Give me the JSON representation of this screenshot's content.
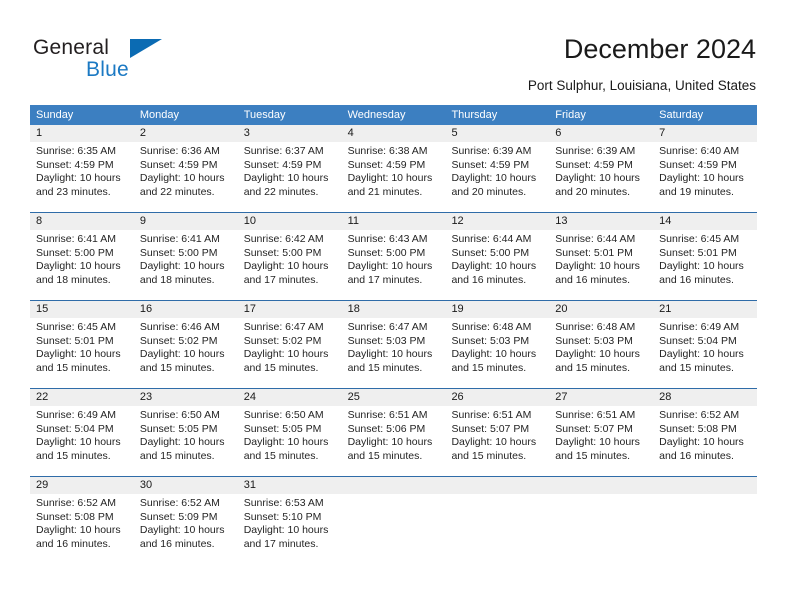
{
  "brand": {
    "name_part1": "General",
    "name_part2": "Blue",
    "accent_color": "#0b6bb3"
  },
  "header": {
    "title": "December 2024",
    "subtitle": "Port Sulphur, Louisiana, United States"
  },
  "calendar": {
    "header_bg": "#3c7fc1",
    "daynum_bg": "#efefef",
    "separator_color": "#2f6ca8",
    "weekdays": [
      "Sunday",
      "Monday",
      "Tuesday",
      "Wednesday",
      "Thursday",
      "Friday",
      "Saturday"
    ],
    "weeks": [
      {
        "days": [
          {
            "num": "1",
            "sunrise": "Sunrise: 6:35 AM",
            "sunset": "Sunset: 4:59 PM",
            "daylight1": "Daylight: 10 hours",
            "daylight2": "and 23 minutes."
          },
          {
            "num": "2",
            "sunrise": "Sunrise: 6:36 AM",
            "sunset": "Sunset: 4:59 PM",
            "daylight1": "Daylight: 10 hours",
            "daylight2": "and 22 minutes."
          },
          {
            "num": "3",
            "sunrise": "Sunrise: 6:37 AM",
            "sunset": "Sunset: 4:59 PM",
            "daylight1": "Daylight: 10 hours",
            "daylight2": "and 22 minutes."
          },
          {
            "num": "4",
            "sunrise": "Sunrise: 6:38 AM",
            "sunset": "Sunset: 4:59 PM",
            "daylight1": "Daylight: 10 hours",
            "daylight2": "and 21 minutes."
          },
          {
            "num": "5",
            "sunrise": "Sunrise: 6:39 AM",
            "sunset": "Sunset: 4:59 PM",
            "daylight1": "Daylight: 10 hours",
            "daylight2": "and 20 minutes."
          },
          {
            "num": "6",
            "sunrise": "Sunrise: 6:39 AM",
            "sunset": "Sunset: 4:59 PM",
            "daylight1": "Daylight: 10 hours",
            "daylight2": "and 20 minutes."
          },
          {
            "num": "7",
            "sunrise": "Sunrise: 6:40 AM",
            "sunset": "Sunset: 4:59 PM",
            "daylight1": "Daylight: 10 hours",
            "daylight2": "and 19 minutes."
          }
        ]
      },
      {
        "days": [
          {
            "num": "8",
            "sunrise": "Sunrise: 6:41 AM",
            "sunset": "Sunset: 5:00 PM",
            "daylight1": "Daylight: 10 hours",
            "daylight2": "and 18 minutes."
          },
          {
            "num": "9",
            "sunrise": "Sunrise: 6:41 AM",
            "sunset": "Sunset: 5:00 PM",
            "daylight1": "Daylight: 10 hours",
            "daylight2": "and 18 minutes."
          },
          {
            "num": "10",
            "sunrise": "Sunrise: 6:42 AM",
            "sunset": "Sunset: 5:00 PM",
            "daylight1": "Daylight: 10 hours",
            "daylight2": "and 17 minutes."
          },
          {
            "num": "11",
            "sunrise": "Sunrise: 6:43 AM",
            "sunset": "Sunset: 5:00 PM",
            "daylight1": "Daylight: 10 hours",
            "daylight2": "and 17 minutes."
          },
          {
            "num": "12",
            "sunrise": "Sunrise: 6:44 AM",
            "sunset": "Sunset: 5:00 PM",
            "daylight1": "Daylight: 10 hours",
            "daylight2": "and 16 minutes."
          },
          {
            "num": "13",
            "sunrise": "Sunrise: 6:44 AM",
            "sunset": "Sunset: 5:01 PM",
            "daylight1": "Daylight: 10 hours",
            "daylight2": "and 16 minutes."
          },
          {
            "num": "14",
            "sunrise": "Sunrise: 6:45 AM",
            "sunset": "Sunset: 5:01 PM",
            "daylight1": "Daylight: 10 hours",
            "daylight2": "and 16 minutes."
          }
        ]
      },
      {
        "days": [
          {
            "num": "15",
            "sunrise": "Sunrise: 6:45 AM",
            "sunset": "Sunset: 5:01 PM",
            "daylight1": "Daylight: 10 hours",
            "daylight2": "and 15 minutes."
          },
          {
            "num": "16",
            "sunrise": "Sunrise: 6:46 AM",
            "sunset": "Sunset: 5:02 PM",
            "daylight1": "Daylight: 10 hours",
            "daylight2": "and 15 minutes."
          },
          {
            "num": "17",
            "sunrise": "Sunrise: 6:47 AM",
            "sunset": "Sunset: 5:02 PM",
            "daylight1": "Daylight: 10 hours",
            "daylight2": "and 15 minutes."
          },
          {
            "num": "18",
            "sunrise": "Sunrise: 6:47 AM",
            "sunset": "Sunset: 5:03 PM",
            "daylight1": "Daylight: 10 hours",
            "daylight2": "and 15 minutes."
          },
          {
            "num": "19",
            "sunrise": "Sunrise: 6:48 AM",
            "sunset": "Sunset: 5:03 PM",
            "daylight1": "Daylight: 10 hours",
            "daylight2": "and 15 minutes."
          },
          {
            "num": "20",
            "sunrise": "Sunrise: 6:48 AM",
            "sunset": "Sunset: 5:03 PM",
            "daylight1": "Daylight: 10 hours",
            "daylight2": "and 15 minutes."
          },
          {
            "num": "21",
            "sunrise": "Sunrise: 6:49 AM",
            "sunset": "Sunset: 5:04 PM",
            "daylight1": "Daylight: 10 hours",
            "daylight2": "and 15 minutes."
          }
        ]
      },
      {
        "days": [
          {
            "num": "22",
            "sunrise": "Sunrise: 6:49 AM",
            "sunset": "Sunset: 5:04 PM",
            "daylight1": "Daylight: 10 hours",
            "daylight2": "and 15 minutes."
          },
          {
            "num": "23",
            "sunrise": "Sunrise: 6:50 AM",
            "sunset": "Sunset: 5:05 PM",
            "daylight1": "Daylight: 10 hours",
            "daylight2": "and 15 minutes."
          },
          {
            "num": "24",
            "sunrise": "Sunrise: 6:50 AM",
            "sunset": "Sunset: 5:05 PM",
            "daylight1": "Daylight: 10 hours",
            "daylight2": "and 15 minutes."
          },
          {
            "num": "25",
            "sunrise": "Sunrise: 6:51 AM",
            "sunset": "Sunset: 5:06 PM",
            "daylight1": "Daylight: 10 hours",
            "daylight2": "and 15 minutes."
          },
          {
            "num": "26",
            "sunrise": "Sunrise: 6:51 AM",
            "sunset": "Sunset: 5:07 PM",
            "daylight1": "Daylight: 10 hours",
            "daylight2": "and 15 minutes."
          },
          {
            "num": "27",
            "sunrise": "Sunrise: 6:51 AM",
            "sunset": "Sunset: 5:07 PM",
            "daylight1": "Daylight: 10 hours",
            "daylight2": "and 15 minutes."
          },
          {
            "num": "28",
            "sunrise": "Sunrise: 6:52 AM",
            "sunset": "Sunset: 5:08 PM",
            "daylight1": "Daylight: 10 hours",
            "daylight2": "and 16 minutes."
          }
        ]
      },
      {
        "days": [
          {
            "num": "29",
            "sunrise": "Sunrise: 6:52 AM",
            "sunset": "Sunset: 5:08 PM",
            "daylight1": "Daylight: 10 hours",
            "daylight2": "and 16 minutes."
          },
          {
            "num": "30",
            "sunrise": "Sunrise: 6:52 AM",
            "sunset": "Sunset: 5:09 PM",
            "daylight1": "Daylight: 10 hours",
            "daylight2": "and 16 minutes."
          },
          {
            "num": "31",
            "sunrise": "Sunrise: 6:53 AM",
            "sunset": "Sunset: 5:10 PM",
            "daylight1": "Daylight: 10 hours",
            "daylight2": "and 17 minutes."
          },
          {
            "num": "",
            "sunrise": "",
            "sunset": "",
            "daylight1": "",
            "daylight2": ""
          },
          {
            "num": "",
            "sunrise": "",
            "sunset": "",
            "daylight1": "",
            "daylight2": ""
          },
          {
            "num": "",
            "sunrise": "",
            "sunset": "",
            "daylight1": "",
            "daylight2": ""
          },
          {
            "num": "",
            "sunrise": "",
            "sunset": "",
            "daylight1": "",
            "daylight2": ""
          }
        ]
      }
    ]
  }
}
